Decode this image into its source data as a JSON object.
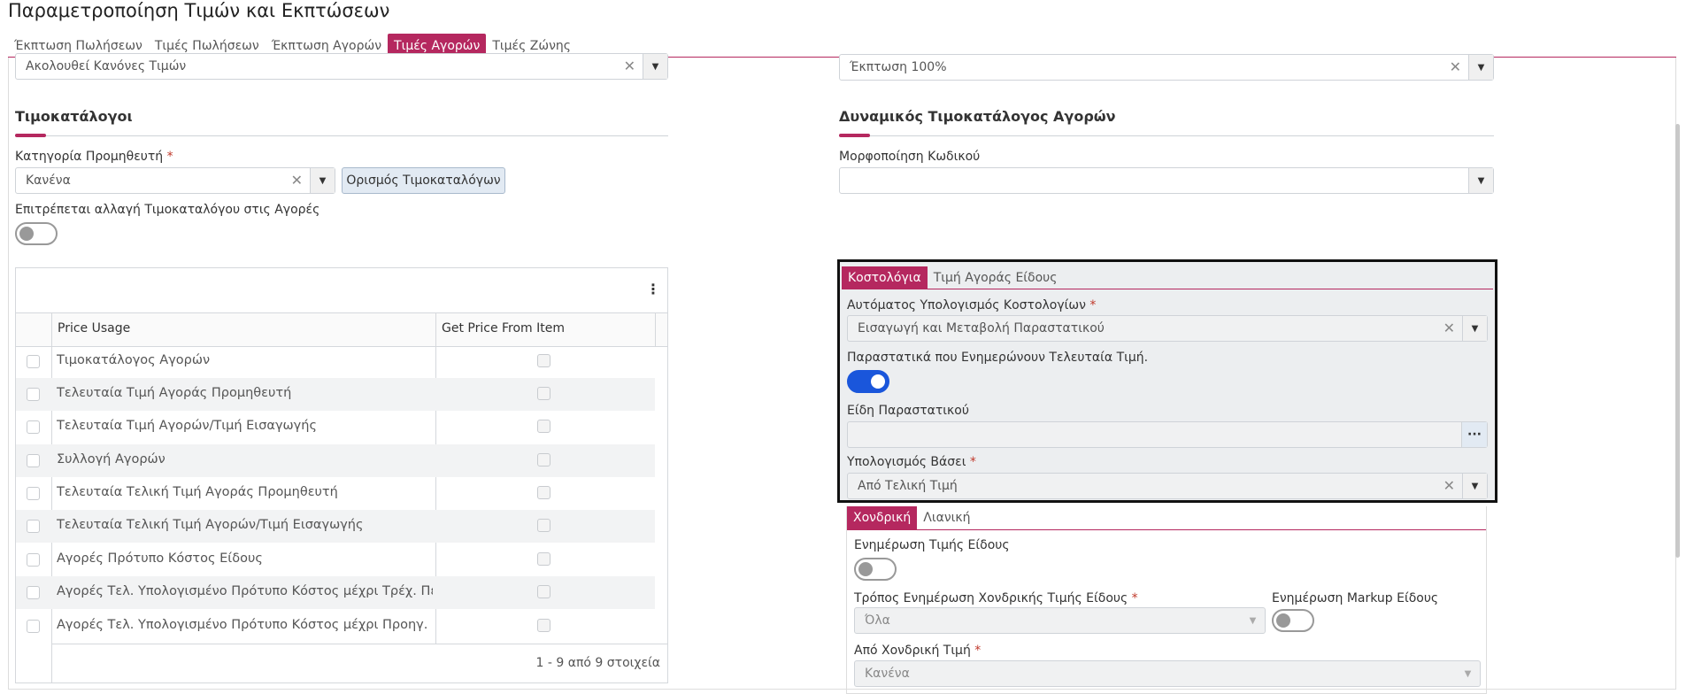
{
  "page": {
    "title": "Παραμετροποίηση Τιμών και Εκπτώσεων"
  },
  "tabs": [
    "Έκπτωση Πωλήσεων",
    "Τιμές Πωλήσεων",
    "Έκπτωση Αγορών",
    "Τιμές Αγορών",
    "Τιμές Ζώνης"
  ],
  "active_tab": "Τιμές Αγορών",
  "top": {
    "left_value": "Ακολουθεί Κανόνες Τιμών",
    "right_value": "Έκπτωση 100%"
  },
  "left": {
    "section_title": "Τιμοκατάλογοι",
    "supplier_category": {
      "label": "Κατηγορία Προμηθευτή",
      "value": "Κανένα"
    },
    "define_button": "Ορισμός Τιμοκαταλόγων",
    "allow_change": {
      "label": "Επιτρέπεται αλλαγή Τιμοκαταλόγου στις Αγορές",
      "on": false
    },
    "grid": {
      "columns": [
        "Price Usage",
        "Get Price From Item"
      ],
      "rows": [
        "Τιμοκατάλογος Αγορών",
        "Τελευταία Τιμή Αγοράς Προμηθευτή",
        "Τελευταία Τιμή Αγορών/Τιμή Εισαγωγής",
        "Συλλογή Αγορών",
        "Τελευταία Τελική Τιμή Αγοράς Προμηθευτή",
        "Τελευταία Τελική Τιμή Αγορών/Τιμή Εισαγωγής",
        "Αγορές Πρότυπο Κόστος Είδους",
        "Αγορές Τελ. Υπολογισμένο Πρότυπο Κόστος μέχρι Τρέχ. Περίοδο",
        "Αγορές Τελ. Υπολογισμένο Πρότυπο Κόστος μέχρι Προηγ. Περίοδο"
      ],
      "footer": "1 - 9 από 9 στοιχεία",
      "menu_icon": "kebab-icon"
    }
  },
  "right": {
    "section_title": "Δυναμικός Τιμοκατάλογος Αγορών",
    "code_format": {
      "label": "Μορφοποίηση Κωδικού",
      "value": ""
    },
    "costing_tabs": [
      "Κοστολόγια",
      "Τιμή Αγοράς Είδους"
    ],
    "auto_calc": {
      "label": "Αυτόματος Υπολογισμός Κοστολογίων",
      "value": "Εισαγωγή και Μεταβολή Παραστατικού"
    },
    "docs_update": {
      "label": "Παραστατικά που Ενημερώνουν Τελευταία Τιμή.",
      "on": true
    },
    "doc_types": {
      "label": "Είδη Παραστατικού",
      "value": "",
      "button": "···"
    },
    "calc_basis": {
      "label": "Υπολογισμός Βάσει",
      "value": "Από Τελική Τιμή"
    },
    "price_tabs": [
      "Χονδρική",
      "Λιανική"
    ],
    "update_item_price": {
      "label": "Ενημέρωση Τιμής Είδους",
      "on": false
    },
    "wholesale_mode": {
      "label": "Τρόπος Ενημέρωση Χονδρικής Τιμής Είδους",
      "value": "Όλα"
    },
    "markup": {
      "label": "Ενημέρωση Markup Είδους",
      "on": false
    },
    "from_wholesale": {
      "label": "Από Χονδρική Τιμή",
      "value": "Κανένα"
    }
  },
  "colors": {
    "accent": "#b5285f",
    "toggle_on": "#1a56db"
  }
}
